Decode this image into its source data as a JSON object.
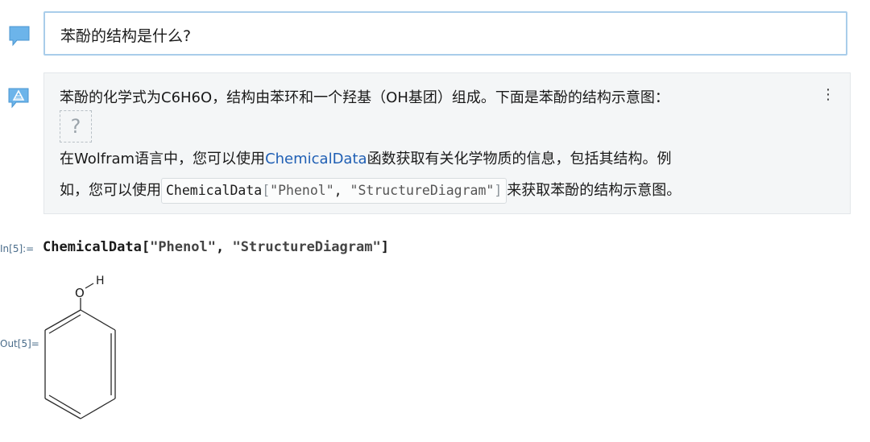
{
  "question": {
    "text": "苯酚的结构是什么?"
  },
  "answer": {
    "line1": "苯酚的化学式为C6H6O，结构由苯环和一个羟基（OH基团）组成。下面是苯酚的结构示意图：",
    "broken_image_glyph": "?",
    "more_menu_glyph": "⋮",
    "line3_prefix": "在Wolfram语言中，您可以使用",
    "line3_link": "ChemicalData",
    "line3_suffix": "函数获取有关化学物质的信息，包括其结构。例",
    "line4_prefix": "如，您可以使用",
    "inline_code": {
      "fn": "ChemicalData",
      "open": "[",
      "arg1": "\"Phenol\"",
      "sep": ", ",
      "arg2": "\"StructureDiagram\"",
      "close": "]"
    },
    "line4_suffix": "来获取苯酚的结构示意图。"
  },
  "cells": {
    "in_label": "In[5]:=",
    "input": {
      "fn": "ChemicalData",
      "open": "[",
      "arg1": "\"Phenol\"",
      "sep": ", ",
      "arg2": "\"StructureDiagram\"",
      "close": "]"
    },
    "out_label": "Out[5]=",
    "structure": {
      "atom_o": "O",
      "atom_h": "H"
    }
  },
  "colors": {
    "question_border": "#a9cdea",
    "answer_bg": "#f4f6f7",
    "link": "#1f5fb4",
    "label": "#4a6c8a",
    "icon_blue": "#5aa7e0"
  },
  "icons": {
    "user": "speech-bubble-icon",
    "assistant": "wolfram-assistant-icon",
    "menu": "vertical-ellipsis-icon"
  }
}
